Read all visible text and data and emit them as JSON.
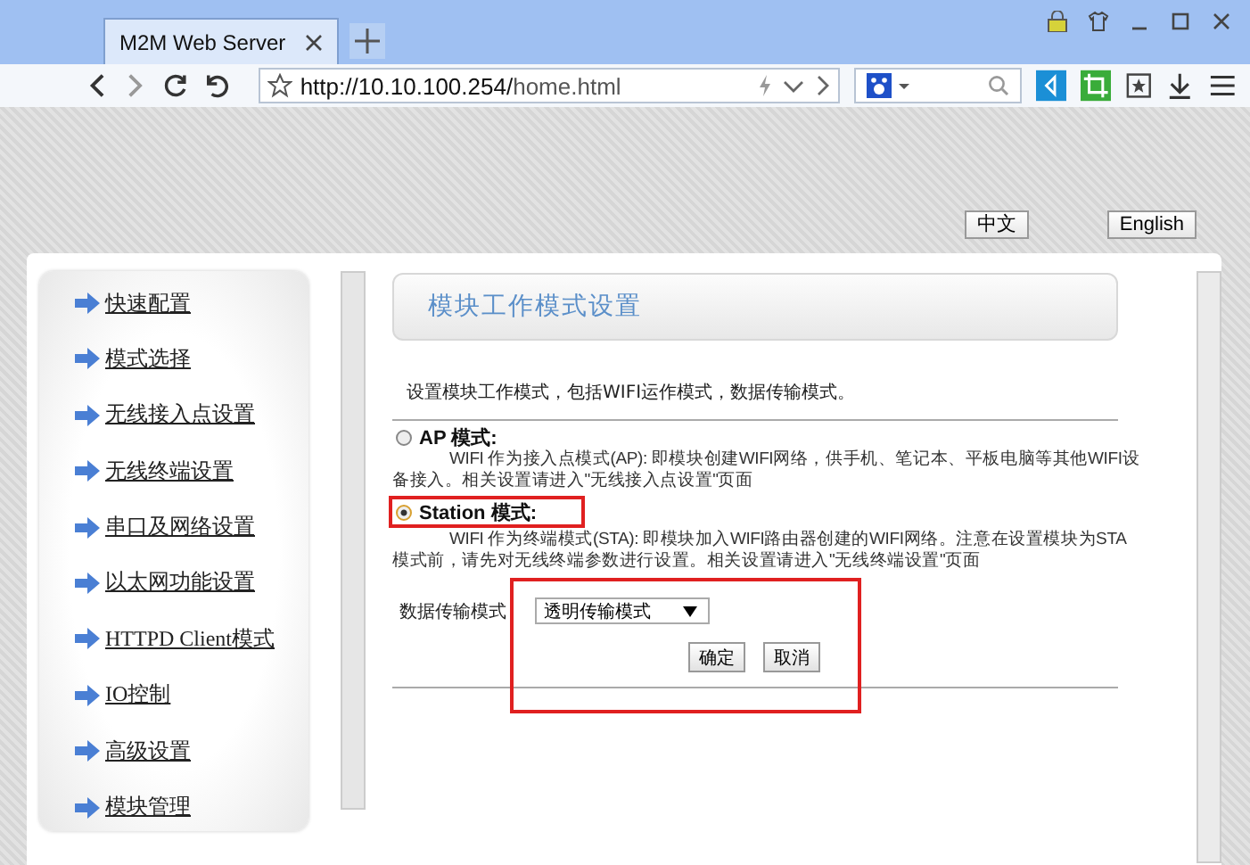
{
  "browser": {
    "tab_title": "M2M Web Server",
    "url_host": "http://10.10.100.254/",
    "url_path": "home.html"
  },
  "language_buttons": [
    "中文",
    "English"
  ],
  "sidebar": {
    "items": [
      {
        "label": "快速配置"
      },
      {
        "label": "模式选择"
      },
      {
        "label": "无线接入点设置"
      },
      {
        "label": "无线终端设置"
      },
      {
        "label": "串口及网络设置"
      },
      {
        "label": "以太网功能设置"
      },
      {
        "label": "HTTPD Client模式"
      },
      {
        "label": "IO控制"
      },
      {
        "label": "高级设置"
      },
      {
        "label": "模块管理"
      }
    ]
  },
  "page": {
    "title": "模块工作模式设置",
    "description": "设置模块工作模式，包括WIFI运作模式，数据传输模式。",
    "modes": [
      {
        "label": "AP 模式:",
        "selected": false,
        "highlighted": false,
        "lines": [
          "WIFI 作为接入点模式(AP): 即模块创建WIFI网络，供手机、笔记本、平板电脑等其他WIFI设",
          "备接入。相关设置请进入\"无线接入点设置\"页面"
        ]
      },
      {
        "label": "Station 模式:",
        "selected": true,
        "highlighted": true,
        "lines": [
          "WIFI 作为终端模式(STA): 即模块加入WIFI路由器创建的WIFI网络。注意在设置模块为STA",
          "模式前，请先对无线终端参数进行设置。相关设置请进入\"无线终端设置\"页面"
        ]
      }
    ],
    "transfer": {
      "label": "数据传输模式",
      "value": "透明传输模式",
      "highlighted": true
    },
    "buttons": [
      "确定",
      "取消"
    ]
  }
}
